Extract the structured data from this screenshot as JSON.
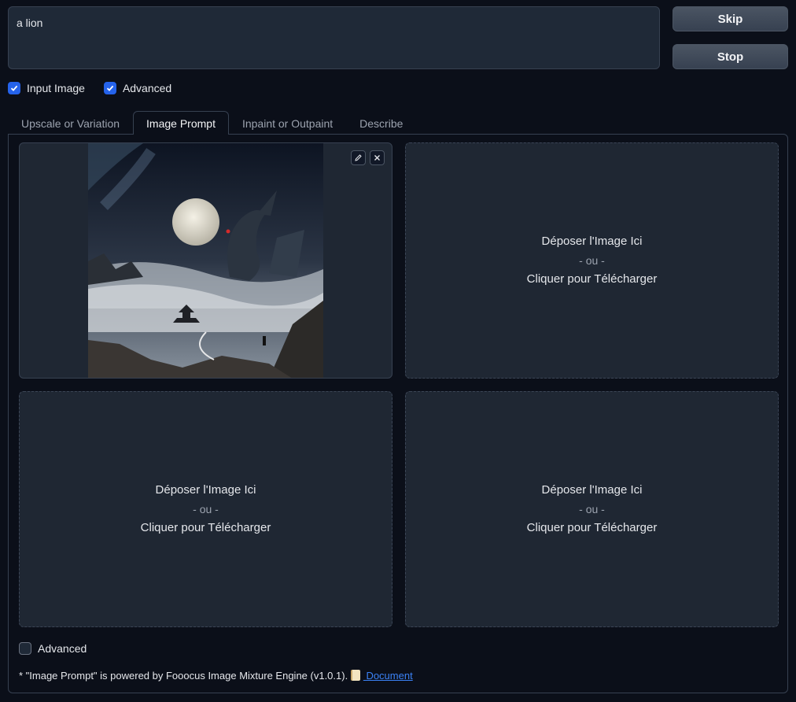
{
  "prompt": {
    "value": "a lion"
  },
  "buttons": {
    "skip": "Skip",
    "stop": "Stop"
  },
  "options": {
    "input_image": {
      "label": "Input Image",
      "checked": true
    },
    "advanced": {
      "label": "Advanced",
      "checked": true
    }
  },
  "tabs": [
    {
      "label": "Upscale or Variation",
      "active": false
    },
    {
      "label": "Image Prompt",
      "active": true
    },
    {
      "label": "Inpaint or Outpaint",
      "active": false
    },
    {
      "label": "Describe",
      "active": false
    }
  ],
  "upload": {
    "drop": "Déposer l'Image Ici",
    "or": "- ou -",
    "click": "Cliquer pour Télécharger"
  },
  "panel": {
    "advanced_label": "Advanced",
    "footnote": "* \"Image Prompt\" is powered by Fooocus Image Mixture Engine (v1.0.1).",
    "doc_link": " Document"
  },
  "colors": {
    "accent": "#2563eb",
    "link": "#3b82f6",
    "background": "#0b0f19",
    "slot": "#1f2733"
  },
  "icons": {
    "edit": "pencil-icon",
    "close": "close-icon",
    "doc": "scroll-icon"
  }
}
